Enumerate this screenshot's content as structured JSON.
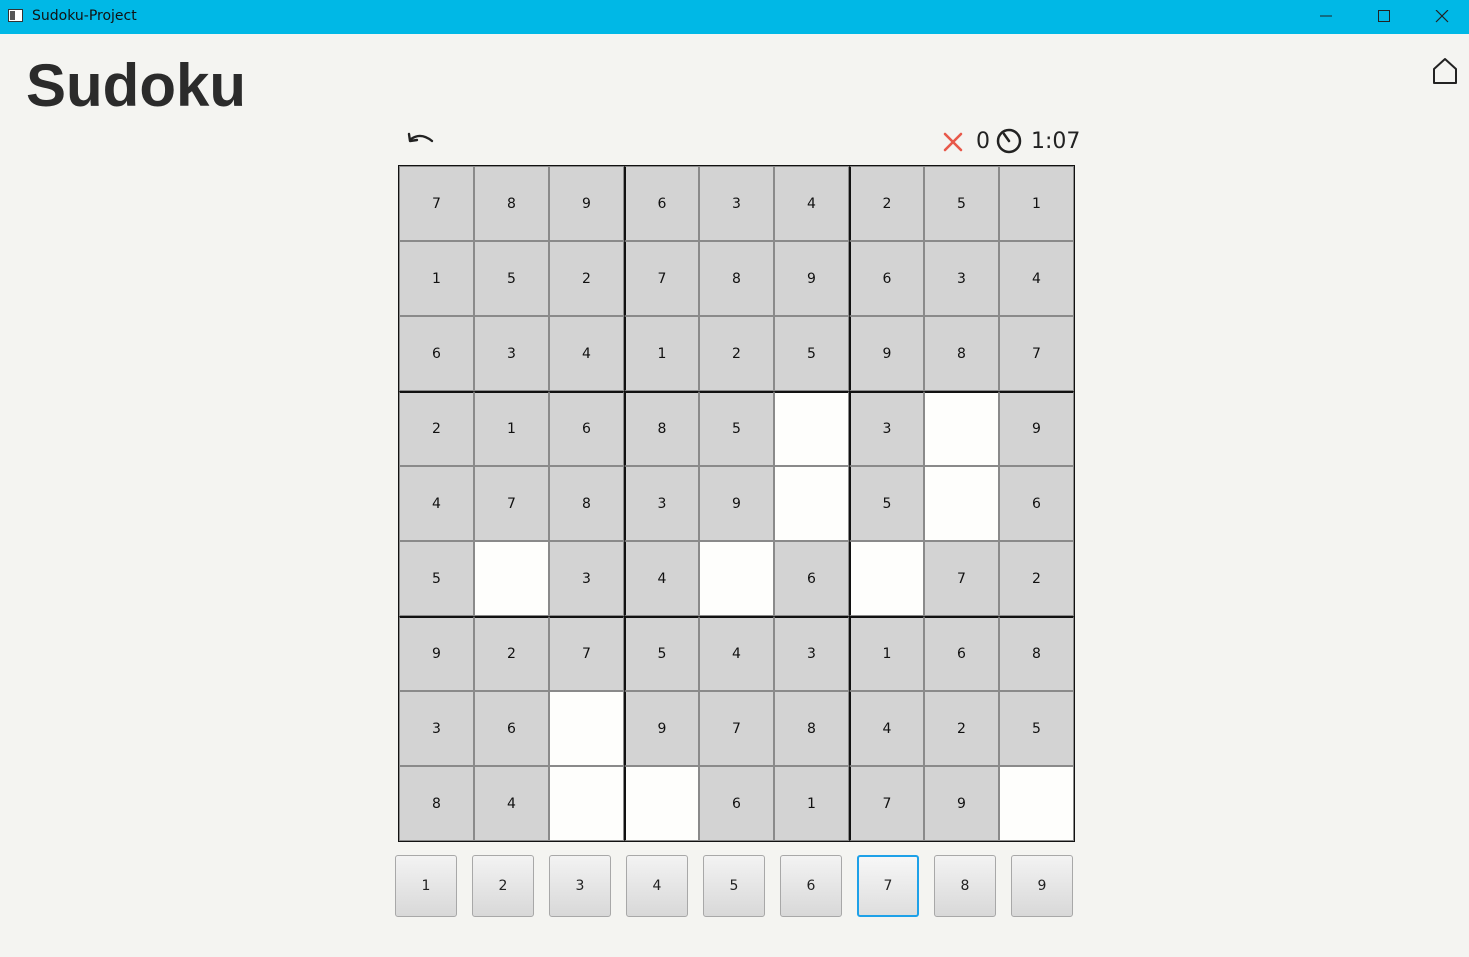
{
  "window": {
    "title": "Sudoku-Project"
  },
  "header": {
    "title": "Sudoku"
  },
  "status": {
    "errors": "0",
    "time": "1:07",
    "error_color": "#e8584a"
  },
  "board": {
    "cells": [
      [
        "7",
        "8",
        "9",
        "6",
        "3",
        "4",
        "2",
        "5",
        "1"
      ],
      [
        "1",
        "5",
        "2",
        "7",
        "8",
        "9",
        "6",
        "3",
        "4"
      ],
      [
        "6",
        "3",
        "4",
        "1",
        "2",
        "5",
        "9",
        "8",
        "7"
      ],
      [
        "2",
        "1",
        "6",
        "8",
        "5",
        "",
        "3",
        "",
        "9"
      ],
      [
        "4",
        "7",
        "8",
        "3",
        "9",
        "",
        "5",
        "",
        "6"
      ],
      [
        "5",
        "",
        "3",
        "4",
        "",
        "6",
        "",
        "7",
        "2"
      ],
      [
        "9",
        "2",
        "7",
        "5",
        "4",
        "3",
        "1",
        "6",
        "8"
      ],
      [
        "3",
        "6",
        "",
        "9",
        "7",
        "8",
        "4",
        "2",
        "5"
      ],
      [
        "8",
        "4",
        "",
        "",
        "6",
        "1",
        "7",
        "9",
        ""
      ]
    ]
  },
  "numpad": {
    "buttons": [
      "1",
      "2",
      "3",
      "4",
      "5",
      "6",
      "7",
      "8",
      "9"
    ],
    "selected": "7"
  },
  "icons": {
    "undo": "undo-icon",
    "home": "home-icon",
    "errors": "close-x-icon",
    "timer": "timer-icon"
  }
}
